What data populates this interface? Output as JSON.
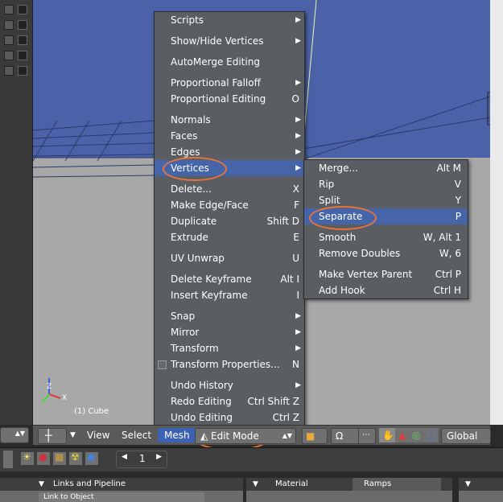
{
  "main_menu": {
    "items": [
      {
        "label": "Scripts",
        "shortcut": "",
        "has_sub": true
      },
      {
        "label": "Show/Hide Vertices",
        "shortcut": "",
        "has_sub": true
      },
      {
        "label": "AutoMerge Editing",
        "shortcut": "",
        "has_sub": false
      },
      {
        "label": "Proportional Falloff",
        "shortcut": "",
        "has_sub": true
      },
      {
        "label": "Proportional Editing",
        "shortcut": "O",
        "has_sub": false
      },
      {
        "label": "Normals",
        "shortcut": "",
        "has_sub": true
      },
      {
        "label": "Faces",
        "shortcut": "",
        "has_sub": true
      },
      {
        "label": "Edges",
        "shortcut": "",
        "has_sub": true
      },
      {
        "label": "Vertices",
        "shortcut": "",
        "has_sub": true,
        "active": true
      },
      {
        "label": "Delete...",
        "shortcut": "X",
        "has_sub": false
      },
      {
        "label": "Make Edge/Face",
        "shortcut": "F",
        "has_sub": false
      },
      {
        "label": "Duplicate",
        "shortcut": "Shift D",
        "has_sub": false
      },
      {
        "label": "Extrude",
        "shortcut": "E",
        "has_sub": false
      },
      {
        "label": "UV Unwrap",
        "shortcut": "U",
        "has_sub": false
      },
      {
        "label": "Delete Keyframe",
        "shortcut": "Alt I",
        "has_sub": false
      },
      {
        "label": "Insert Keyframe",
        "shortcut": "I",
        "has_sub": false
      },
      {
        "label": "Snap",
        "shortcut": "",
        "has_sub": true
      },
      {
        "label": "Mirror",
        "shortcut": "",
        "has_sub": true
      },
      {
        "label": "Transform",
        "shortcut": "",
        "has_sub": true
      },
      {
        "label": "Transform Properties...",
        "shortcut": "N",
        "has_sub": false,
        "checkbox": true
      },
      {
        "label": "Undo History",
        "shortcut": "",
        "has_sub": true
      },
      {
        "label": "Redo Editing",
        "shortcut": "Ctrl Shift Z",
        "has_sub": false
      },
      {
        "label": "Undo Editing",
        "shortcut": "Ctrl Z",
        "has_sub": false
      }
    ]
  },
  "sub_menu": {
    "items": [
      {
        "label": "Merge...",
        "shortcut": "Alt M"
      },
      {
        "label": "Rip",
        "shortcut": "V"
      },
      {
        "label": "Split",
        "shortcut": "Y"
      },
      {
        "label": "Separate",
        "shortcut": "P",
        "active": true
      },
      {
        "label": "Smooth",
        "shortcut": "W, Alt 1"
      },
      {
        "label": "Remove Doubles",
        "shortcut": "W, 6"
      },
      {
        "label": "Make Vertex Parent",
        "shortcut": "Ctrl P"
      },
      {
        "label": "Add Hook",
        "shortcut": "Ctrl H"
      }
    ]
  },
  "viewport": {
    "object_label": "(1) Cube",
    "axis_z": "Z",
    "axis_x": "X"
  },
  "header": {
    "view_label": "View",
    "select_label": "Select",
    "mesh_label": "Mesh",
    "mode_label": "Edit Mode",
    "global_label": "Global"
  },
  "bottom": {
    "frame_value": "1",
    "panel_links": "Links and Pipeline",
    "panel_material": "Material",
    "panel_ramps": "Ramps",
    "panel_link_obj": "Link to Object"
  },
  "colors": {
    "highlight": "#4565a8",
    "annotation_circle": "#e6743a",
    "viewport_bg": "#4b62a8",
    "floor": "#a8a8a8"
  }
}
